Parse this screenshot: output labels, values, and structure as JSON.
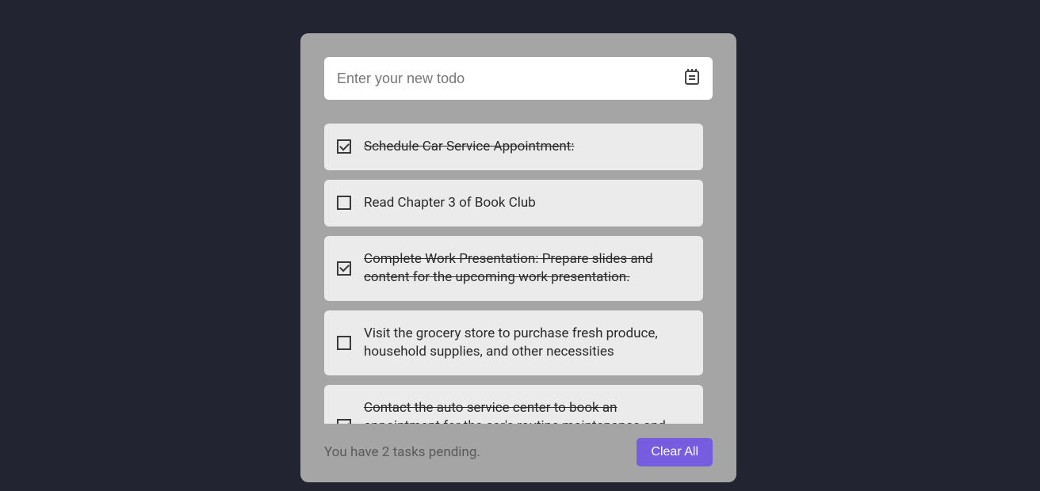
{
  "input": {
    "placeholder": "Enter your new todo",
    "value": ""
  },
  "todos": [
    {
      "text": "Schedule Car Service Appointment:",
      "done": true
    },
    {
      "text": "Read Chapter 3 of Book Club",
      "done": false
    },
    {
      "text": "Complete Work Presentation: Prepare slides and content for the upcoming work presentation.",
      "done": true
    },
    {
      "text": "Visit the grocery store to purchase fresh produce, household supplies, and other necessities",
      "done": false
    },
    {
      "text": "Contact the auto service center to book an appointment for the car's routine maintenance and safety inspection.",
      "done": true
    }
  ],
  "footer": {
    "pending_text": "You have 2 tasks pending.",
    "clear_label": "Clear All"
  }
}
